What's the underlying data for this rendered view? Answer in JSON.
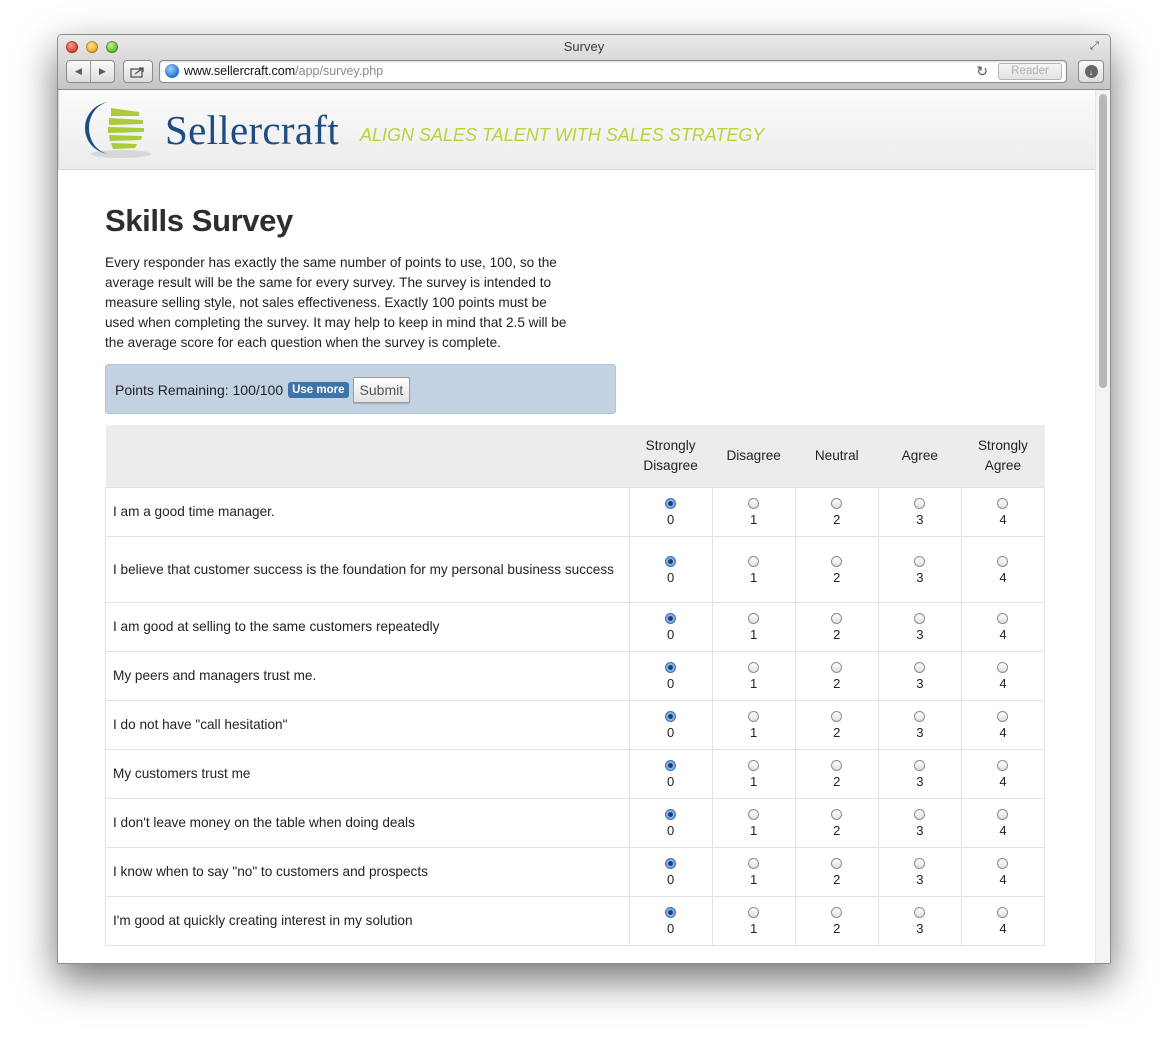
{
  "window": {
    "title": "Survey",
    "url_host": "www.sellercraft.com",
    "url_path": "/app/survey.php",
    "reader_label": "Reader"
  },
  "site": {
    "brand": "Sellercraft",
    "tagline": "ALIGN SALES TALENT WITH SALES STRATEGY",
    "colors": {
      "brand": "#1e4c82",
      "tagline": "#b7d43c"
    }
  },
  "page": {
    "title": "Skills Survey",
    "intro": "Every responder has exactly the same number of points to use, 100, so the average result will be the same for every survey. The survey is intended to measure selling style, not sales effectiveness. Exactly 100 points must be used when completing the survey. It may help to keep in mind that 2.5 will be the average score for each question when the survey is complete."
  },
  "points": {
    "label": "Points Remaining: 100/100",
    "use_more": "Use more",
    "submit": "Submit"
  },
  "survey": {
    "options": [
      {
        "label": "Strongly Disagree",
        "value": "0"
      },
      {
        "label": "Disagree",
        "value": "1"
      },
      {
        "label": "Neutral",
        "value": "2"
      },
      {
        "label": "Agree",
        "value": "3"
      },
      {
        "label": "Strongly Agree",
        "value": "4"
      }
    ],
    "questions": [
      {
        "text": "I am a good time manager.",
        "selected": 0
      },
      {
        "text": "I believe that customer success is the foundation for my personal business success",
        "selected": 0
      },
      {
        "text": "I am good at selling to the same customers repeatedly",
        "selected": 0
      },
      {
        "text": "My peers and managers trust me.",
        "selected": 0
      },
      {
        "text": "I do not have \"call hesitation\"",
        "selected": 0
      },
      {
        "text": "My customers trust me",
        "selected": 0
      },
      {
        "text": "I don't leave money on the table when doing deals",
        "selected": 0
      },
      {
        "text": "I know when to say \"no\" to customers and prospects",
        "selected": 0
      },
      {
        "text": "I'm good at quickly creating interest in my solution",
        "selected": 0
      }
    ]
  }
}
